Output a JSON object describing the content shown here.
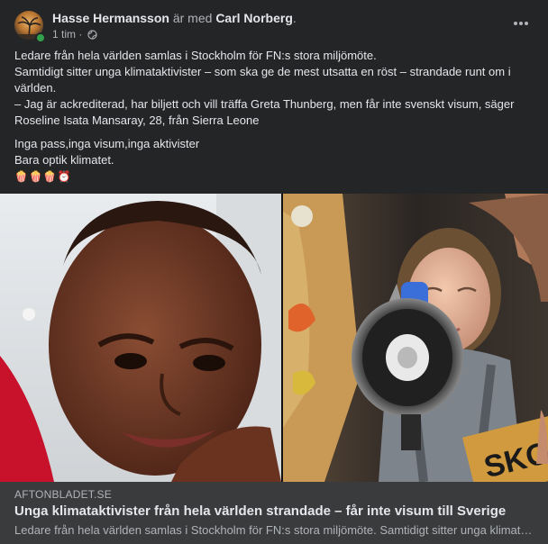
{
  "post": {
    "author": "Hasse Hermansson",
    "with_text": "är med",
    "tagged": "Carl Norberg",
    "punct": ".",
    "time": "1 tim",
    "separator": "·",
    "icons": {
      "privacy": "globe-icon",
      "more": "more-options-icon",
      "presence": "online-status"
    },
    "colors": {
      "background": "#242526",
      "text": "#e4e6eb",
      "muted": "#b0b3b8",
      "link_bg": "#3a3b3c",
      "online": "#31a24c"
    },
    "body": {
      "p1": "Ledare från hela världen samlas i Stockholm för FN:s stora miljömöte.",
      "p2": "Samtidigt sitter unga klimataktivister – som ska ge de mest utsatta en röst – strandade runt om i världen.",
      "p3": "– Jag är ackrediterad, har biljett och vill träffa Greta Thunberg, men får inte svenskt visum, säger Roseline Isata Mansaray, 28, från Sierra Leone",
      "p4": "Inga pass,inga visum,inga aktivister",
      "p5": "Bara optik klimatet.",
      "emojis": "🍿🍿🍿⏰"
    },
    "sign_text": "SKO"
  },
  "link": {
    "domain": "AFTONBLADET.SE",
    "title": "Unga klimataktivister från hela världen strandade – får inte visum till Sverige",
    "description": "Ledare från hela världen samlas i Stockholm för FN:s stora miljömöte. Samtidigt sitter unga klimataktivister"
  }
}
